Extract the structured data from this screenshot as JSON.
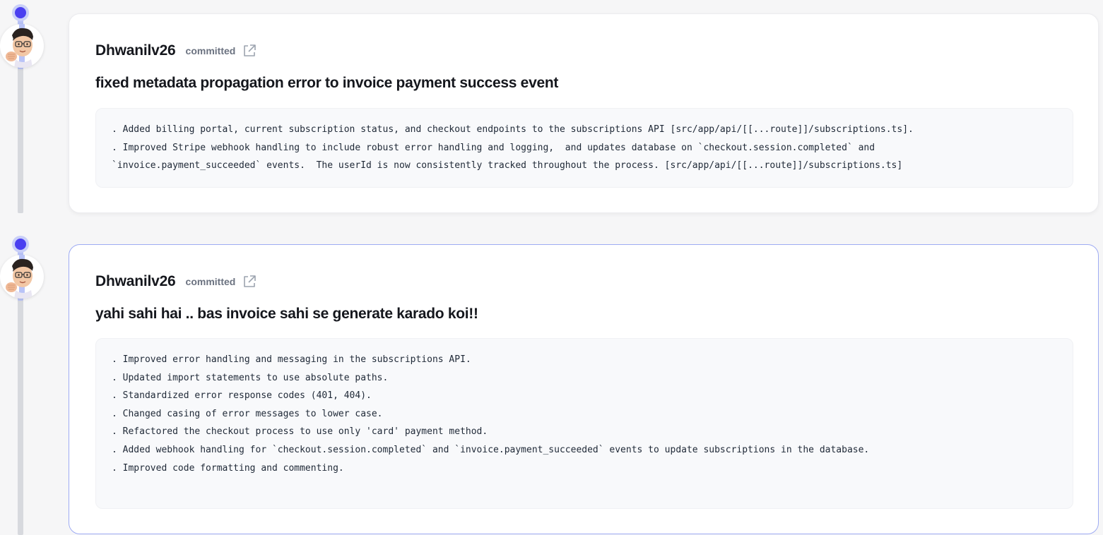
{
  "commits": [
    {
      "author": "Dhwanilv26",
      "verb": "committed",
      "message": "fixed metadata propagation error to invoice payment success event",
      "description": [
        ". Added billing portal, current subscription status, and checkout endpoints to the subscriptions API [src/app/api/[[...route]]/subscriptions.ts].",
        ". Improved Stripe webhook handling to include robust error handling and logging,  and updates database on `checkout.session.completed` and",
        "`invoice.payment_succeeded` events.  The userId is now consistently tracked throughout the process. [src/app/api/[[...route]]/subscriptions.ts]"
      ]
    },
    {
      "author": "Dhwanilv26",
      "verb": "committed",
      "message": "yahi sahi hai .. bas invoice sahi se generate karado koi!!",
      "description": [
        ". Improved error handling and messaging in the subscriptions API.",
        ". Updated import statements to use absolute paths.",
        ". Standardized error response codes (401, 404).",
        ". Changed casing of error messages to lower case.",
        ". Refactored the checkout process to use only 'card' payment method.",
        ". Added webhook handling for `checkout.session.completed` and `invoice.payment_succeeded` events to update subscriptions in the database.",
        ". Improved code formatting and commenting."
      ]
    }
  ],
  "icons": {
    "external_link": "external-link-icon",
    "avatar": "memoji-avatar"
  },
  "colors": {
    "accent": "#4a3ff0",
    "timeline_active": "#b9c3f7",
    "timeline_inactive": "#d7d9de",
    "selected_border": "#9eabf3"
  }
}
